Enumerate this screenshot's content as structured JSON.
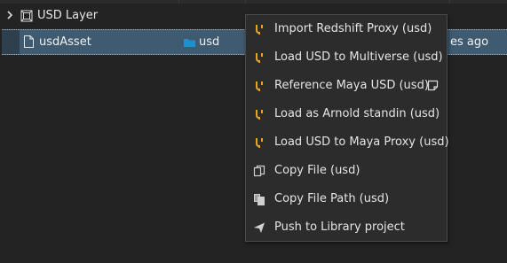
{
  "tree": {
    "layer_row": {
      "label": "USD Layer",
      "icon": "usd-layer-icon"
    },
    "asset_row": {
      "name": "usdAsset",
      "type": "usd",
      "date_partial": "es ago",
      "file_icon": "file-icon",
      "folder_icon": "folder-icon"
    }
  },
  "context_menu": {
    "items": [
      {
        "label": "Import Redshift Proxy (usd)",
        "icon": "usd-icon"
      },
      {
        "label": "Load USD to Multiverse (usd)",
        "icon": "usd-icon"
      },
      {
        "label": "Reference Maya USD (usd)",
        "icon": "usd-icon",
        "extra_icon": "option-box-icon"
      },
      {
        "label": "Load as Arnold standin (usd)",
        "icon": "usd-icon"
      },
      {
        "label": "Load USD to Maya Proxy (usd)",
        "icon": "usd-icon"
      },
      {
        "label": "Copy File (usd)",
        "icon": "copy-icon"
      },
      {
        "label": "Copy File Path (usd)",
        "icon": "copy-path-icon"
      },
      {
        "label": "Push to Library project",
        "icon": "send-icon"
      }
    ]
  },
  "colors": {
    "background": "#232323",
    "selection": "#3f5b72",
    "menu_background": "#2c2c2c",
    "usd_icon": "#e9a31e",
    "folder": "#1f8fcf"
  }
}
